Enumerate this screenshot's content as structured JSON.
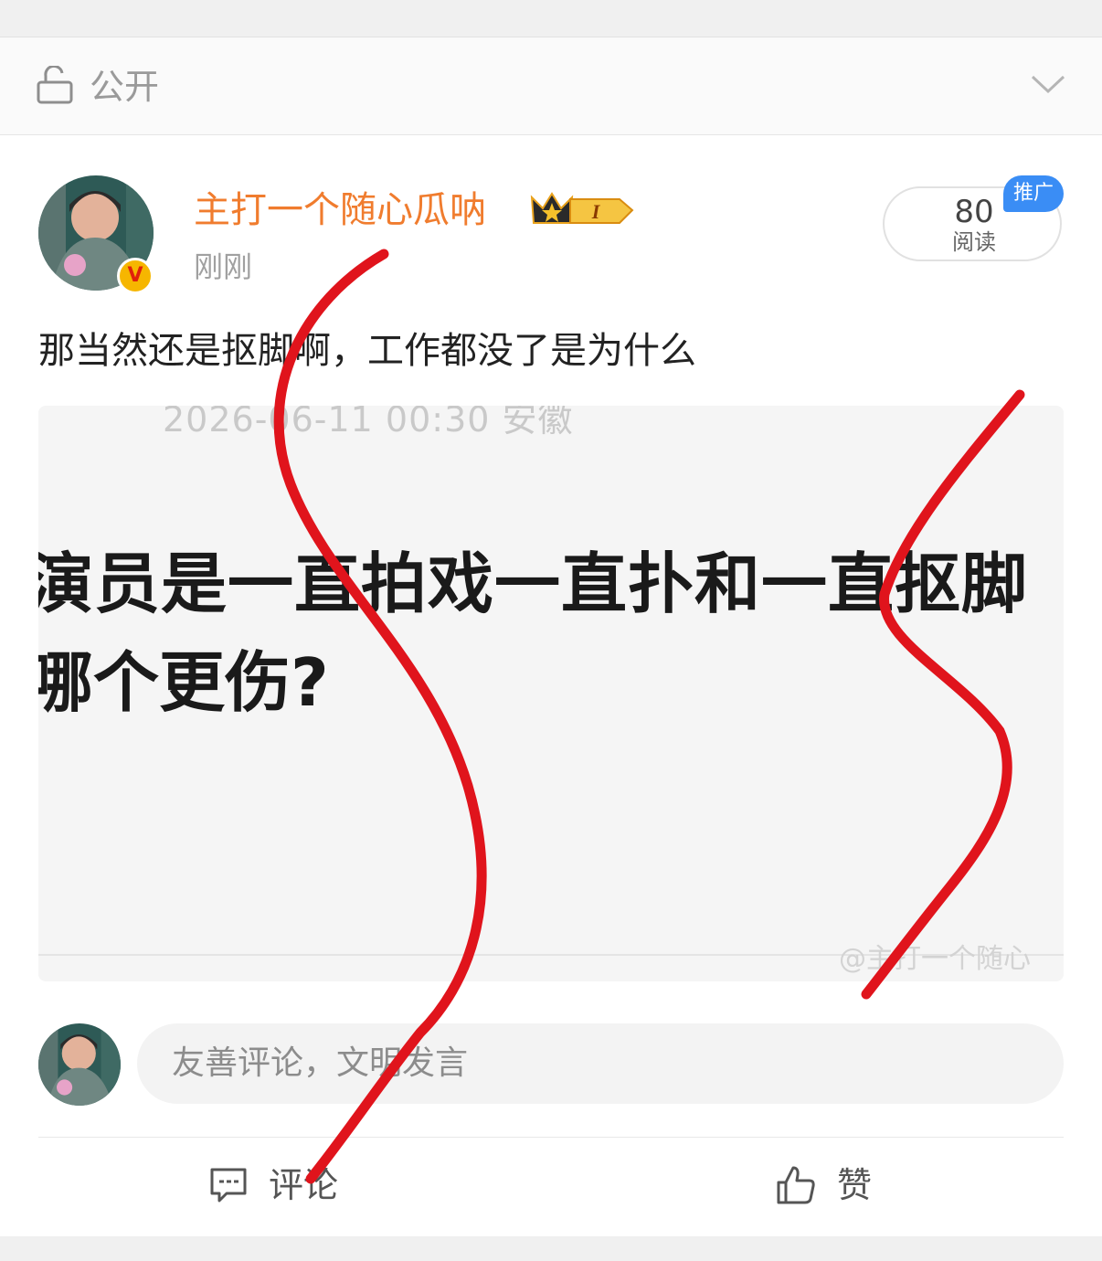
{
  "visibility": {
    "label": "公开",
    "lock_icon": "lock-open-icon",
    "chevron_icon": "chevron-down-icon"
  },
  "post": {
    "username": "主打一个随心瓜呐",
    "timestamp": "刚刚",
    "text": "那当然还是抠脚啊，工作都没了是为什么",
    "reads": {
      "count": "80",
      "label": "阅读"
    },
    "promo_badge": "推广",
    "verified_mark": "V",
    "level_badge": "I",
    "image": {
      "date_line": "2026-06-11 00:30  安徽",
      "question_line1": "演员是一直拍戏一直扑和一直抠脚",
      "question_line2": "哪个更伤?",
      "watermark": "@主打一个随心"
    }
  },
  "comment_box": {
    "placeholder": "友善评论，文明发言"
  },
  "actions": {
    "comment_label": "评论",
    "like_label": "赞"
  },
  "colors": {
    "username": "#f07c2e",
    "promo": "#3a8df5",
    "scribble": "#e0141c"
  }
}
